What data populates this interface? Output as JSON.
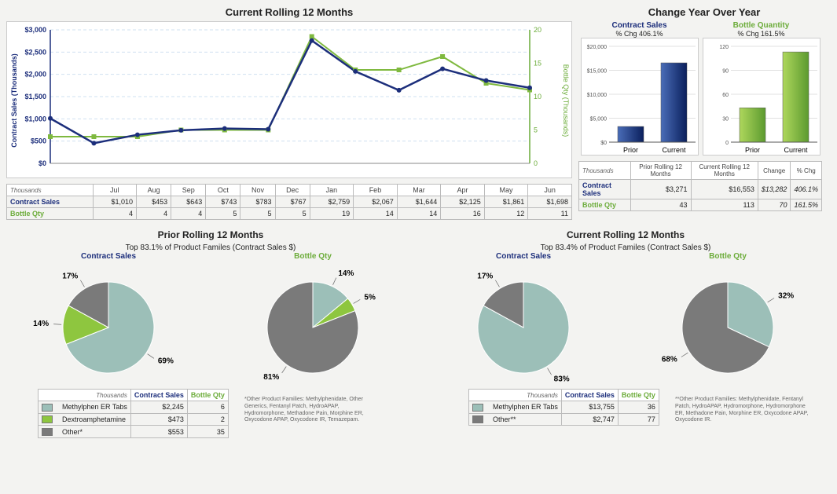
{
  "top": {
    "line": {
      "title": "Current Rolling 12 Months",
      "y1label": "Contract Sales (Thousands)",
      "y2label": "Bottle Qty (Thousands)",
      "y1max": 3000,
      "y2max": 20
    },
    "months": [
      "Jul",
      "Aug",
      "Sep",
      "Oct",
      "Nov",
      "Dec",
      "Jan",
      "Feb",
      "Mar",
      "Apr",
      "May",
      "Jun"
    ],
    "thousands_label": "Thousands",
    "contract_label": "Contract Sales",
    "bottle_label": "Bottle Qty",
    "contract_vals": [
      "$1,010",
      "$453",
      "$643",
      "$743",
      "$783",
      "$767",
      "$2,759",
      "$2,067",
      "$1,644",
      "$2,125",
      "$1,861",
      "$1,698"
    ],
    "bottle_vals": [
      "4",
      "4",
      "4",
      "5",
      "5",
      "5",
      "19",
      "14",
      "14",
      "16",
      "12",
      "11"
    ],
    "yoy": {
      "title": "Change Year Over Year",
      "contract": {
        "header": "Contract Sales",
        "sub": "% Chg 406.1%",
        "prior": "Prior",
        "current": "Current",
        "ymax": 20000,
        "vals": [
          3271,
          16553
        ]
      },
      "bottle": {
        "header": "Bottle Quantity",
        "sub": "% Chg 161.5%",
        "prior": "Prior",
        "current": "Current",
        "ymax": 120,
        "vals": [
          43,
          113
        ]
      },
      "table": {
        "headers": [
          "Prior Rolling 12 Months",
          "Current Rolling 12 Months",
          "Change",
          "% Chg"
        ],
        "r1": [
          "$3,271",
          "$16,553",
          "$13,282",
          "406.1%"
        ],
        "r2": [
          "43",
          "113",
          "70",
          "161.5%"
        ]
      }
    }
  },
  "pies": {
    "prior": {
      "title": "Prior Rolling 12 Months",
      "sub": "Top 83.1% of Product Familes (Contract Sales $)",
      "contract_label": "Contract Sales",
      "bottle_label": "Bottle Qty",
      "contract_pie": [
        {
          "label": "69%",
          "v": 69,
          "c": "#9cbfb8"
        },
        {
          "label": "14%",
          "v": 14,
          "c": "#8ec63f"
        },
        {
          "label": "17%",
          "v": 17,
          "c": "#7a7a7a"
        }
      ],
      "bottle_pie": [
        {
          "label": "14%",
          "v": 14,
          "c": "#9cbfb8"
        },
        {
          "label": "5%",
          "v": 5,
          "c": "#8ec63f"
        },
        {
          "label": "81%",
          "v": 81,
          "c": "#7a7a7a"
        }
      ],
      "table": [
        {
          "name": "Methylphen ER Tabs",
          "cs": "$2,245",
          "bq": "6",
          "c": "#9cbfb8"
        },
        {
          "name": "Dextroamphetamine",
          "cs": "$473",
          "bq": "2",
          "c": "#8ec63f"
        },
        {
          "name": "Other*",
          "cs": "$553",
          "bq": "35",
          "c": "#7a7a7a"
        }
      ],
      "footnote": "*Other Product Families: Methylphenidate, Other Generics, Fentanyl Patch, HydroAPAP, Hydromorphone, Methadone Pain, Morphine ER, Oxycodone APAP, Oxycodone IR, Temazepam."
    },
    "current": {
      "title": "Current Rolling 12 Months",
      "sub": "Top 83.4% of Product Familes (Contract Sales $)",
      "contract_label": "Contract Sales",
      "bottle_label": "Bottle Qty",
      "contract_pie": [
        {
          "label": "83%",
          "v": 83,
          "c": "#9cbfb8"
        },
        {
          "label": "17%",
          "v": 17,
          "c": "#7a7a7a"
        }
      ],
      "bottle_pie": [
        {
          "label": "32%",
          "v": 32,
          "c": "#9cbfb8"
        },
        {
          "label": "68%",
          "v": 68,
          "c": "#7a7a7a"
        }
      ],
      "table": [
        {
          "name": "Methylphen ER Tabs",
          "cs": "$13,755",
          "bq": "36",
          "c": "#9cbfb8"
        },
        {
          "name": "Other**",
          "cs": "$2,747",
          "bq": "77",
          "c": "#7a7a7a"
        }
      ],
      "footnote": "**Other Product Families: Methylphenidate, Fentanyl Patch, HydroAPAP, Hydromorphone, Hydromorphone ER, Methadone Pain, Morphine ER, Oxycodone APAP, Oxycodone IR."
    },
    "table_headers": [
      "Contract Sales",
      "Bottle Qty"
    ]
  },
  "chart_data": {
    "line_chart": {
      "type": "line",
      "categories": [
        "Jul",
        "Aug",
        "Sep",
        "Oct",
        "Nov",
        "Dec",
        "Jan",
        "Feb",
        "Mar",
        "Apr",
        "May",
        "Jun"
      ],
      "series": [
        {
          "name": "Contract Sales ($,Thousands)",
          "axis": "left",
          "values": [
            1010,
            453,
            643,
            743,
            783,
            767,
            2759,
            2067,
            1644,
            2125,
            1861,
            1698
          ]
        },
        {
          "name": "Bottle Qty (Thousands)",
          "axis": "right",
          "values": [
            4,
            4,
            4,
            5,
            5,
            5,
            19,
            14,
            14,
            16,
            12,
            11
          ]
        }
      ],
      "ylim_left": [
        0,
        3000
      ],
      "ylim_right": [
        0,
        20
      ],
      "title": "Current Rolling 12 Months"
    },
    "yoy_bars": [
      {
        "type": "bar",
        "title": "Contract Sales % Chg 406.1%",
        "categories": [
          "Prior",
          "Current"
        ],
        "values": [
          3271,
          16553
        ],
        "ylim": [
          0,
          20000
        ]
      },
      {
        "type": "bar",
        "title": "Bottle Quantity % Chg 161.5%",
        "categories": [
          "Prior",
          "Current"
        ],
        "values": [
          43,
          113
        ],
        "ylim": [
          0,
          120
        ]
      }
    ],
    "pies": [
      {
        "type": "pie",
        "title": "Prior Contract Sales",
        "slices": [
          {
            "name": "Methylphen ER Tabs",
            "v": 69
          },
          {
            "name": "Dextroamphetamine",
            "v": 14
          },
          {
            "name": "Other",
            "v": 17
          }
        ]
      },
      {
        "type": "pie",
        "title": "Prior Bottle Qty",
        "slices": [
          {
            "name": "Methylphen ER Tabs",
            "v": 14
          },
          {
            "name": "Dextroamphetamine",
            "v": 5
          },
          {
            "name": "Other",
            "v": 81
          }
        ]
      },
      {
        "type": "pie",
        "title": "Current Contract Sales",
        "slices": [
          {
            "name": "Methylphen ER Tabs",
            "v": 83
          },
          {
            "name": "Other",
            "v": 17
          }
        ]
      },
      {
        "type": "pie",
        "title": "Current Bottle Qty",
        "slices": [
          {
            "name": "Methylphen ER Tabs",
            "v": 32
          },
          {
            "name": "Other",
            "v": 68
          }
        ]
      }
    ]
  }
}
